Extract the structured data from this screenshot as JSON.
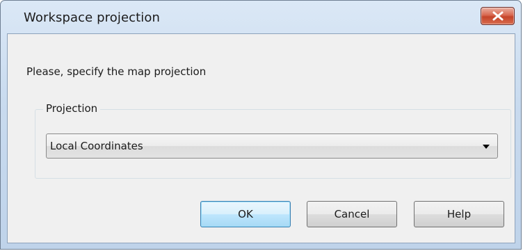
{
  "window": {
    "title": "Workspace projection",
    "close_icon": "close-icon"
  },
  "dialog": {
    "prompt": "Please, specify the map projection",
    "group_label": "Projection",
    "projection": {
      "selected": "Local Coordinates",
      "arrow_icon": "chevron-down-icon"
    }
  },
  "buttons": {
    "ok": "OK",
    "cancel": "Cancel",
    "help": "Help"
  },
  "colors": {
    "titlebar": "#c9dbef",
    "client": "#f0f0f0",
    "close": "#c54429",
    "default_button": "#a7d9f5"
  }
}
